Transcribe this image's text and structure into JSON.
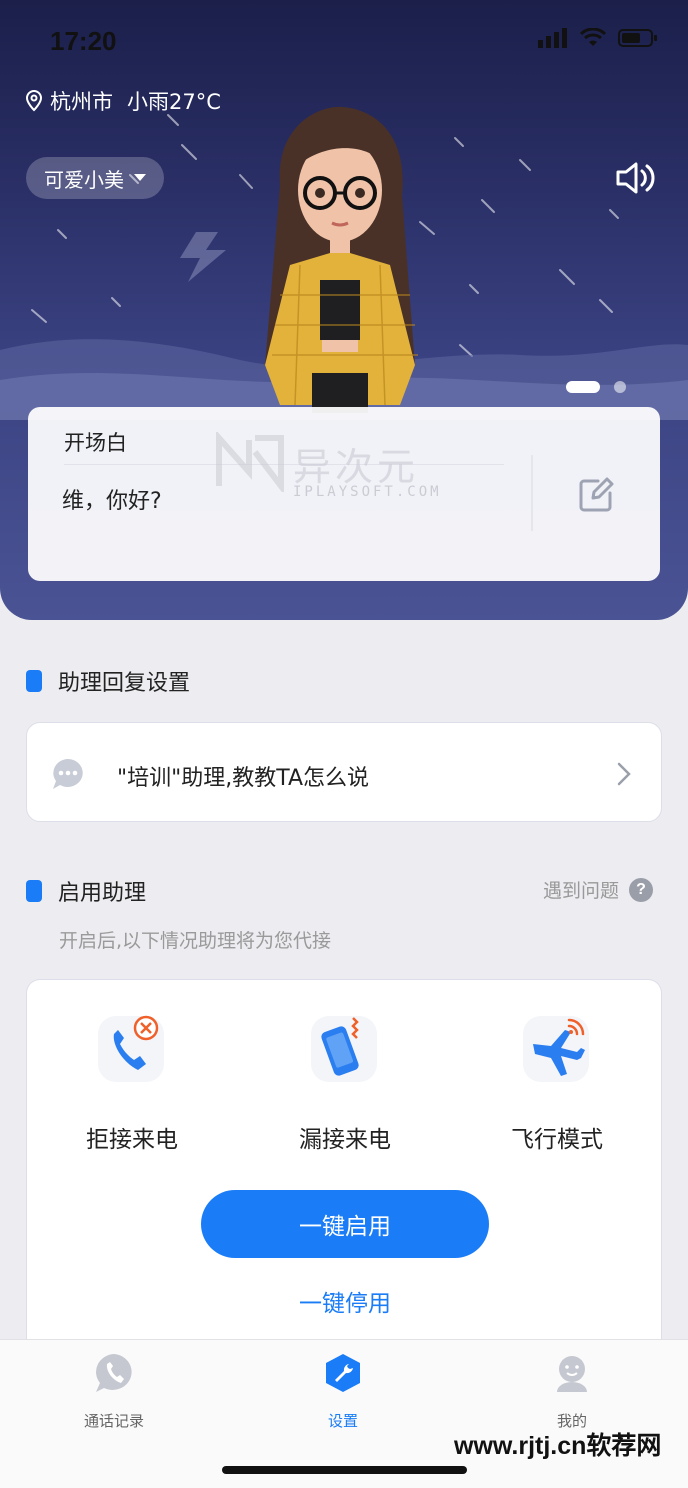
{
  "status_bar": {
    "time": "17:20"
  },
  "weather": {
    "city": "杭州市",
    "condition": "小雨27°C"
  },
  "assistant": {
    "selected_name": "可爱小美"
  },
  "opener": {
    "title": "开场白",
    "text": "维，你好?"
  },
  "watermark": {
    "brand": "异次元",
    "domain": "IPLAYSOFT.COM"
  },
  "reply_section": {
    "title": "助理回复设置",
    "training_label": "\"培训\"助理,教教TA怎么说"
  },
  "enable_section": {
    "title": "启用助理",
    "problem_link": "遇到问题",
    "description": "开启后,以下情况助理将为您代接",
    "features": [
      {
        "label": "拒接来电",
        "icon": "phone-declined-icon"
      },
      {
        "label": "漏接来电",
        "icon": "phone-missed-icon"
      },
      {
        "label": "飞行模式",
        "icon": "airplane-mode-icon"
      }
    ],
    "enable_button": "一键启用",
    "disable_button": "一键停用"
  },
  "tabs": [
    {
      "label": "通话记录",
      "icon": "phone-bubble-icon",
      "active": false
    },
    {
      "label": "设置",
      "icon": "wrench-icon",
      "active": true
    },
    {
      "label": "我的",
      "icon": "user-icon",
      "active": false
    }
  ],
  "site_watermark": "www.rjtj.cn软荐网",
  "colors": {
    "accent": "#1a7cf6",
    "hero_top": "#1b1f4a",
    "hero_bottom": "#4a5394"
  }
}
